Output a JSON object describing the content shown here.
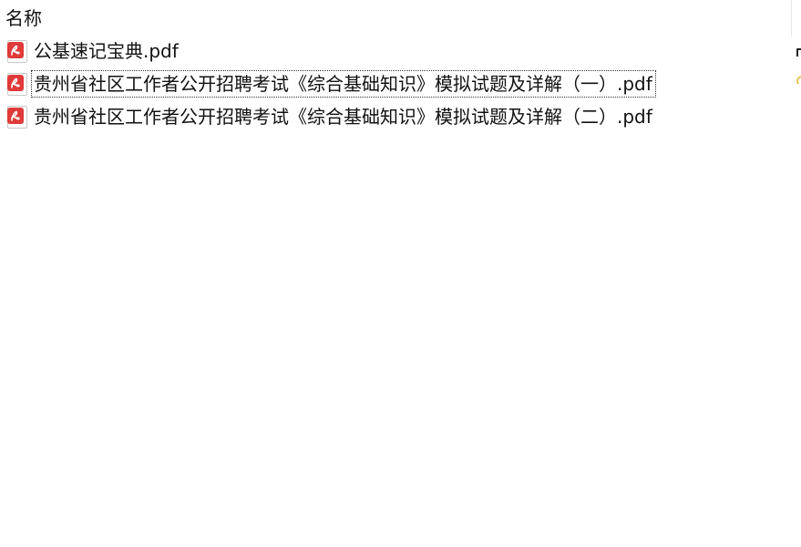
{
  "header": {
    "column_name": "名称"
  },
  "files": [
    {
      "name": "公基速记宝典.pdf",
      "icon": "pdf-icon",
      "focused": false
    },
    {
      "name": "贵州省社区工作者公开招聘考试《综合基础知识》模拟试题及详解（一）.pdf",
      "icon": "pdf-icon",
      "focused": true
    },
    {
      "name": "贵州省社区工作者公开招聘考试《综合基础知识》模拟试题及详解（二）.pdf",
      "icon": "pdf-icon",
      "focused": false
    }
  ],
  "colors": {
    "pdf_badge": "#e03a3a",
    "background": "#ffffff",
    "text": "#111111"
  }
}
